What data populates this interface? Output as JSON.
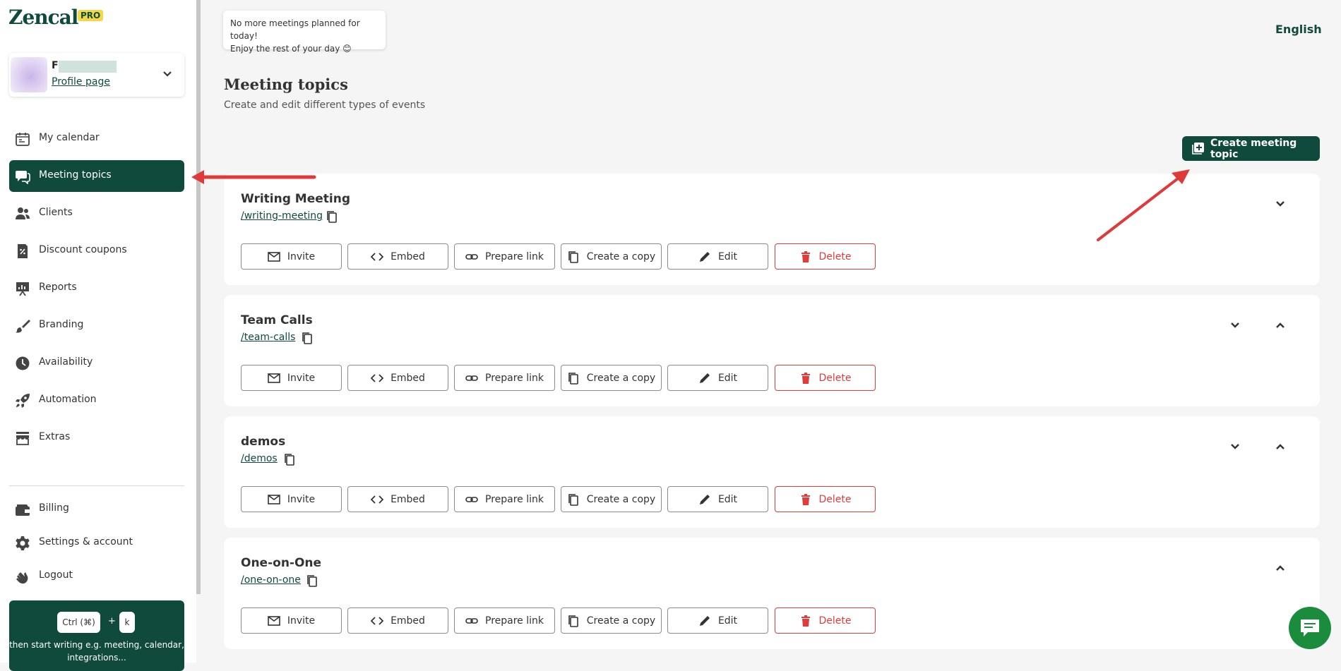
{
  "app": {
    "logo": "Zencal",
    "badge": "PRO"
  },
  "profile": {
    "name": "F",
    "link": "Profile page"
  },
  "nav": {
    "items": [
      {
        "label": "My calendar",
        "icon": "calendar-icon"
      },
      {
        "label": "Meeting topics",
        "icon": "chat-bubbles-icon",
        "active": true
      },
      {
        "label": "Clients",
        "icon": "people-icon"
      },
      {
        "label": "Discount coupons",
        "icon": "coupon-icon"
      },
      {
        "label": "Reports",
        "icon": "presentation-icon"
      },
      {
        "label": "Branding",
        "icon": "brush-icon"
      },
      {
        "label": "Availability",
        "icon": "clock-icon"
      },
      {
        "label": "Automation",
        "icon": "rocket-icon"
      },
      {
        "label": "Extras",
        "icon": "store-icon"
      }
    ],
    "bottom": [
      {
        "label": "Billing",
        "icon": "wallet-icon"
      },
      {
        "label": "Settings & account",
        "icon": "gear-icon"
      },
      {
        "label": "Logout",
        "icon": "wave-hand-icon"
      }
    ]
  },
  "shortcut": {
    "key1": "Ctrl (⌘)",
    "plus": "+",
    "key2": "k",
    "hint": "then start writing e.g. meeting, calendar, integrations..."
  },
  "toast": {
    "line1": "No more meetings planned for today!",
    "line2": "Enjoy the rest of your day 😊"
  },
  "language": "English",
  "page": {
    "title": "Meeting topics",
    "subtitle": "Create and edit different types of events",
    "create_label": "Create meeting topic"
  },
  "actions": {
    "invite": "Invite",
    "embed": "Embed",
    "prepare": "Prepare link",
    "copy": "Create a copy",
    "edit": "Edit",
    "delete": "Delete"
  },
  "topics": [
    {
      "title": "Writing Meeting",
      "slug": "/writing-meeting"
    },
    {
      "title": "Team Calls",
      "slug": "/team-calls"
    },
    {
      "title": "demos",
      "slug": "/demos"
    },
    {
      "title": "One-on-One",
      "slug": "/one-on-one"
    }
  ],
  "colors": {
    "brand": "#0f4a3c",
    "danger": "#e03c3c",
    "pro": "#f3d64a",
    "arrow": "#e0393a"
  }
}
